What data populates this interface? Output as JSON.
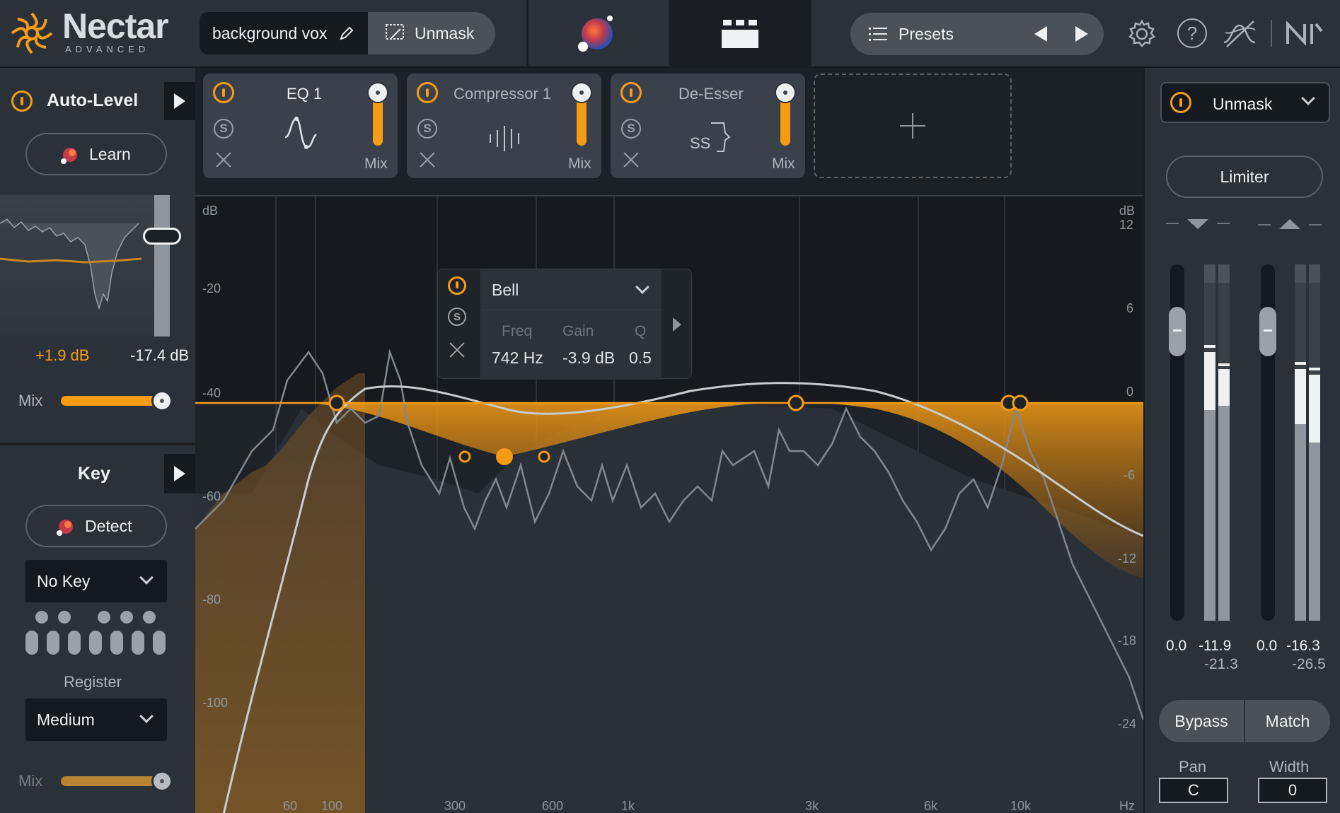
{
  "header": {
    "logo_title": "Nectar",
    "logo_subtitle": "ADVANCED",
    "preset_name": "background vox",
    "unmask_label": "Unmask",
    "presets_label": "Presets",
    "icons": [
      "pencil-icon",
      "unmask-icon",
      "assistant-orb-icon",
      "module-view-icon",
      "list-icon",
      "prev-arrow-icon",
      "next-arrow-icon",
      "settings-gear-icon",
      "help-icon",
      "signal-icon",
      "ni-logo-icon"
    ]
  },
  "auto_level": {
    "title": "Auto-Level",
    "learn_label": "Learn",
    "gain_readout": "+1.9 dB",
    "level_readout": "-17.4 dB",
    "mix_label": "Mix",
    "mix_value": 0.93
  },
  "key": {
    "title": "Key",
    "detect_label": "Detect",
    "key_value": "No Key",
    "register_label": "Register",
    "register_value": "Medium",
    "mix_label": "Mix",
    "mix_value": 0.93
  },
  "modules": [
    {
      "name": "EQ 1",
      "mix_label": "Mix",
      "mix": 0.85
    },
    {
      "name": "Compressor 1",
      "mix_label": "Mix",
      "mix": 0.85
    },
    {
      "name": "De-Esser",
      "mix_label": "Mix",
      "mix": 0.85
    }
  ],
  "eq": {
    "left_unit": "dB",
    "right_unit": "dB",
    "left_ticks": [
      "-20",
      "-40",
      "-60",
      "-80",
      "-100"
    ],
    "right_ticks": [
      "12",
      "6",
      "0",
      "-6",
      "-12",
      "-18",
      "-24"
    ],
    "freq_ticks": [
      "60",
      "100",
      "300",
      "600",
      "1k",
      "3k",
      "6k",
      "10k",
      "Hz"
    ],
    "band_popup": {
      "shape": "Bell",
      "freq_label": "Freq",
      "gain_label": "Gain",
      "q_label": "Q",
      "freq_value": "742 Hz",
      "gain_value": "-3.9 dB",
      "q_value": "0.5"
    }
  },
  "right_panel": {
    "unmask_label": "Unmask",
    "limiter_label": "Limiter",
    "meter1_top": "0.0",
    "meter1_peak": "-11.9",
    "meter1_rms": "-21.3",
    "meter2_top": "0.0",
    "meter2_peak": "-16.3",
    "meter2_rms": "-26.5",
    "bypass_label": "Bypass",
    "match_label": "Match",
    "pan_label": "Pan",
    "pan_value": "C",
    "width_label": "Width",
    "width_value": "0"
  },
  "colors": {
    "accent": "#f59b14",
    "background": "#1c2128",
    "panel": "#2b3139"
  }
}
